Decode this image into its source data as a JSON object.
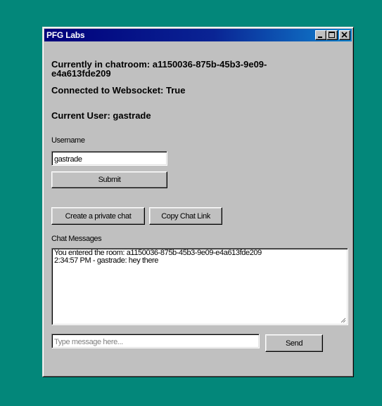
{
  "window": {
    "title": "PFG Labs",
    "controls": {
      "minimize_icon": "minimize-icon",
      "maximize_icon": "maximize-icon",
      "close_icon": "close-icon"
    }
  },
  "status": {
    "chatroom_line1": "Currently in chatroom: a1150036-875b-45b3-9e09-",
    "chatroom_line2": "e4a613fde209",
    "connection": "Connected to Websocket: True",
    "current_user": "Current User: gastrade"
  },
  "username_form": {
    "label": "Username",
    "value": "gastrade",
    "submit_label": "Submit"
  },
  "actions": {
    "private_chat_label": "Create a private chat",
    "copy_link_label": "Copy Chat Link"
  },
  "chat": {
    "label": "Chat Messages",
    "messages": [
      "You entered the room: a1150036-875b-45b3-9e09-e4a613fde209",
      "2:34:57 PM - gastrade: hey there"
    ],
    "input_placeholder": "Type message here...",
    "send_label": "Send"
  },
  "colors": {
    "desktop": "#03877a",
    "window_face": "#c0c0c0",
    "titlebar_start": "#00007b",
    "titlebar_end": "#1084d0"
  }
}
